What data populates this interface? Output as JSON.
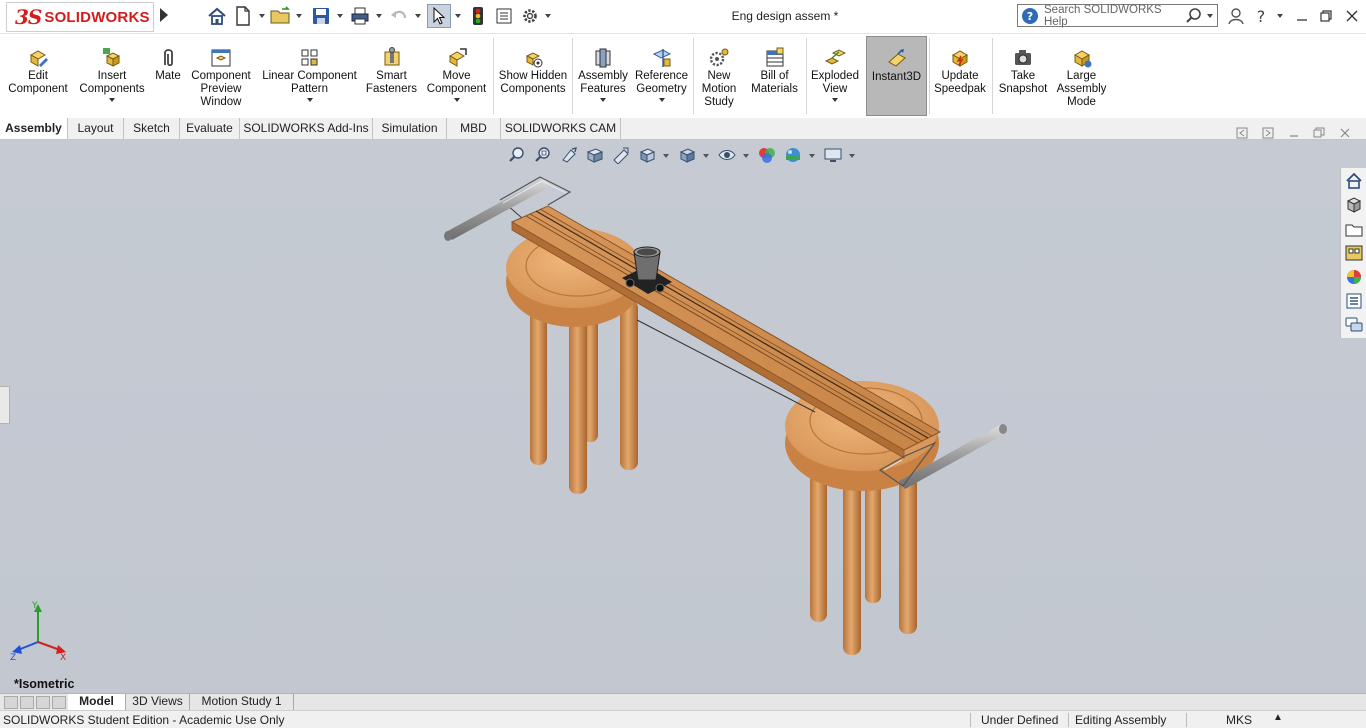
{
  "app": {
    "brand_ds": "3S",
    "brand_name": "SOLIDWORKS",
    "document_title": "Eng design assem *",
    "search_placeholder": "Search SOLIDWORKS Help"
  },
  "quick_access": {
    "icons": [
      "home-icon",
      "new-document-icon",
      "open-folder-icon",
      "save-icon",
      "print-icon",
      "undo-icon",
      "select-pointer-icon",
      "rebuild-traffic-light-icon",
      "file-properties-icon",
      "options-gear-icon"
    ]
  },
  "command_manager": {
    "tools": [
      {
        "id": "edit-component",
        "label": "Edit Component"
      },
      {
        "id": "insert-components",
        "label": "Insert Components"
      },
      {
        "id": "mate",
        "label": "Mate"
      },
      {
        "id": "component-preview-window",
        "label": "Component Preview Window"
      },
      {
        "id": "linear-component-pattern",
        "label": "Linear Component Pattern"
      },
      {
        "id": "smart-fasteners",
        "label": "Smart Fasteners"
      },
      {
        "id": "move-component",
        "label": "Move Component"
      },
      {
        "id": "show-hidden-components",
        "label": "Show Hidden Components"
      },
      {
        "id": "assembly-features",
        "label": "Assembly Features"
      },
      {
        "id": "reference-geometry",
        "label": "Reference Geometry"
      },
      {
        "id": "new-motion-study",
        "label": "New Motion Study"
      },
      {
        "id": "bill-of-materials",
        "label": "Bill of Materials"
      },
      {
        "id": "exploded-view",
        "label": "Exploded View"
      },
      {
        "id": "instant3d",
        "label": "Instant3D"
      },
      {
        "id": "update-speedpak",
        "label": "Update Speedpak"
      },
      {
        "id": "take-snapshot",
        "label": "Take Snapshot"
      },
      {
        "id": "large-assembly-mode",
        "label": "Large Assembly Mode"
      }
    ]
  },
  "tabs": [
    "Assembly",
    "Layout",
    "Sketch",
    "Evaluate",
    "SOLIDWORKS Add-Ins",
    "Simulation",
    "MBD",
    "SOLIDWORKS CAM"
  ],
  "active_tab": "Assembly",
  "graphics": {
    "view_orientation": "*Isometric",
    "heads_up_icons": [
      "zoom-to-fit-icon",
      "zoom-to-area-icon",
      "previous-view-icon",
      "section-view-icon",
      "dynamic-annotation-icon",
      "view-orientation-icon",
      "display-style-icon",
      "hide-show-items-icon",
      "edit-appearance-icon",
      "apply-scene-icon",
      "view-settings-icon"
    ],
    "task_pane_icons": [
      "solidworks-resources-icon",
      "design-library-icon",
      "file-explorer-icon",
      "view-palette-icon",
      "appearances-icon",
      "custom-properties-icon",
      "solidworks-forum-icon"
    ],
    "triad_labels": {
      "x": "X",
      "y": "Y",
      "z": "Z"
    }
  },
  "bottom_tabs": [
    "Model",
    "3D Views",
    "Motion Study 1"
  ],
  "active_bottom_tab": "Model",
  "status_bar": {
    "left": "SOLIDWORKS Student Edition - Academic Use Only",
    "definition": "Under Defined",
    "mode": "Editing Assembly",
    "units": "MKS"
  },
  "colors": {
    "brand_red": "#d41c1c",
    "viewport_bg": "#c4c9d2",
    "wood": "#d99a5c",
    "selected_tool": "#b8b8b8"
  }
}
